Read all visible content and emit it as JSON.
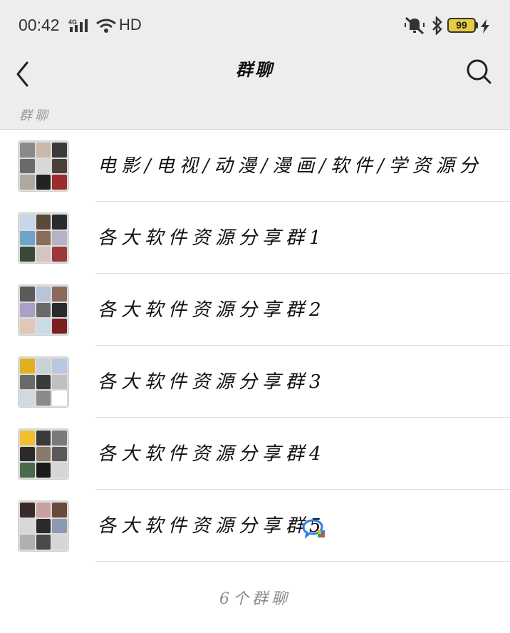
{
  "status_bar": {
    "time": "00:42",
    "network": "4G",
    "hd": "HD",
    "battery": "99"
  },
  "nav": {
    "title": "群聊"
  },
  "section": {
    "label": "群聊"
  },
  "groups": [
    {
      "name": "电影/电视/动漫/漫画/软件/学资源分",
      "avatar_colors": [
        "#8a8a8a",
        "#c9b9a9",
        "#3a3a3a",
        "#6b6b6b",
        "#d8d8d8",
        "#4a3f3a",
        "#b0a8a0",
        "#222222",
        "#9c2b2b"
      ]
    },
    {
      "name": "各大软件资源分享群1",
      "avatar_colors": [
        "#c7d6e8",
        "#5a4a3a",
        "#2b2b2b",
        "#6fa3c7",
        "#8a6d5a",
        "#b7b0c9",
        "#3a4a3a",
        "#d2c7c0",
        "#9a3a3a"
      ]
    },
    {
      "name": "各大软件资源分享群2",
      "avatar_colors": [
        "#5a5a5a",
        "#b8c4d8",
        "#8a6a5a",
        "#a8a0c8",
        "#6a6a6a",
        "#2a2a2a",
        "#e0c8b8",
        "#c8dde8",
        "#7a2020"
      ]
    },
    {
      "name": "各大软件资源分享群3",
      "avatar_colors": [
        "#e0b020",
        "#c8d0d8",
        "#b8c8e0",
        "#6a6a6a",
        "#3a3a3a",
        "#c0c0c0",
        "#d0d8e0",
        "#8a8a8a",
        "#ffffff"
      ]
    },
    {
      "name": "各大软件资源分享群4",
      "avatar_colors": [
        "#f0c030",
        "#3a3a3a",
        "#7a7a7a",
        "#2a2a2a",
        "#8a7a6a",
        "#5a5a5a",
        "#4a6a4a",
        "#1a1a1a",
        "#d6d6d6"
      ]
    },
    {
      "name": "各大软件资源分享群5",
      "avatar_colors": [
        "#3a2a2a",
        "#c8a0a0",
        "#6a4a3a",
        "#d8d8d8",
        "#2a2a2a",
        "#8a9ab0",
        "#b0b0b0",
        "#4a4a4a",
        "#d6d6d6"
      ],
      "has_badge_icon": true
    }
  ],
  "footer": {
    "count": "6个群聊"
  },
  "icons": {
    "back": "chevron-left-icon",
    "search": "search-icon",
    "badge": "enterprise-chat-icon"
  }
}
